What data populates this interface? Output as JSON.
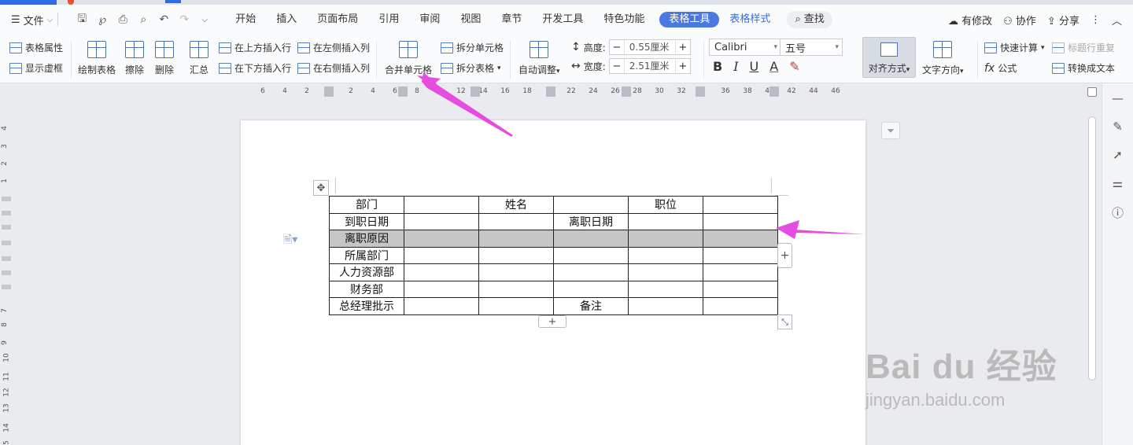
{
  "menubar": {
    "file_label": "文件",
    "tabs": [
      "开始",
      "插入",
      "页面布局",
      "引用",
      "审阅",
      "视图",
      "章节",
      "开发工具",
      "特色功能"
    ],
    "active_tab": "表格工具",
    "style_tab": "表格样式",
    "search_label": "查找",
    "modified_label": "有修改",
    "collab_label": "协作",
    "share_label": "分享"
  },
  "ribbon": {
    "table_props": "表格属性",
    "show_gridlines": "显示虚框",
    "draw_table": "绘制表格",
    "eraser": "擦除",
    "delete": "删除",
    "summary": "汇总",
    "insert_above": "在上方插入行",
    "insert_below": "在下方插入行",
    "insert_left": "在左侧插入列",
    "insert_right": "在右侧插入列",
    "merge_cells": "合并单元格",
    "split_cells": "拆分单元格",
    "split_table": "拆分表格",
    "auto_fit": "自动调整",
    "height_label": "高度:",
    "height_value": "0.55厘米",
    "width_label": "宽度:",
    "width_value": "2.51厘米",
    "font_name": "Calibri",
    "font_size": "五号",
    "align_label": "对齐方式",
    "text_dir_label": "文字方向",
    "quick_calc": "快速计算",
    "formula": "公式",
    "repeat_header": "标题行重复",
    "to_text": "转换成文本"
  },
  "ruler": {
    "h_ticks": [
      "6",
      "4",
      "2",
      "2",
      "4",
      "6",
      "8",
      "12",
      "14",
      "16",
      "18",
      "22",
      "24",
      "26",
      "28",
      "30",
      "32",
      "36",
      "38",
      "40",
      "42",
      "44",
      "46"
    ],
    "v_ticks": [
      "4",
      "3",
      "2",
      "1",
      "7",
      "8",
      "9",
      "10",
      "11",
      "12",
      "13",
      "14",
      "15"
    ]
  },
  "table": {
    "rows": [
      [
        "部门",
        "",
        "姓名",
        "",
        "职位",
        ""
      ],
      [
        "到职日期",
        "",
        "",
        "离职日期",
        "",
        ""
      ],
      [
        "离职原因",
        "",
        "",
        "",
        "",
        ""
      ],
      [
        "所属部门",
        "",
        "",
        "",
        "",
        ""
      ],
      [
        "人力资源部",
        "",
        "",
        "",
        "",
        ""
      ],
      [
        "财务部",
        "",
        "",
        "",
        "",
        ""
      ],
      [
        "总经理批示",
        "",
        "",
        "备注",
        "",
        ""
      ]
    ],
    "highlight_color": "#c6c6c6"
  },
  "colors": {
    "accent": "#4a78e0",
    "annotation": "#e64ce0"
  },
  "watermark": {
    "brand": "Bai du 经验",
    "url": "jingyan.baidu.com"
  }
}
